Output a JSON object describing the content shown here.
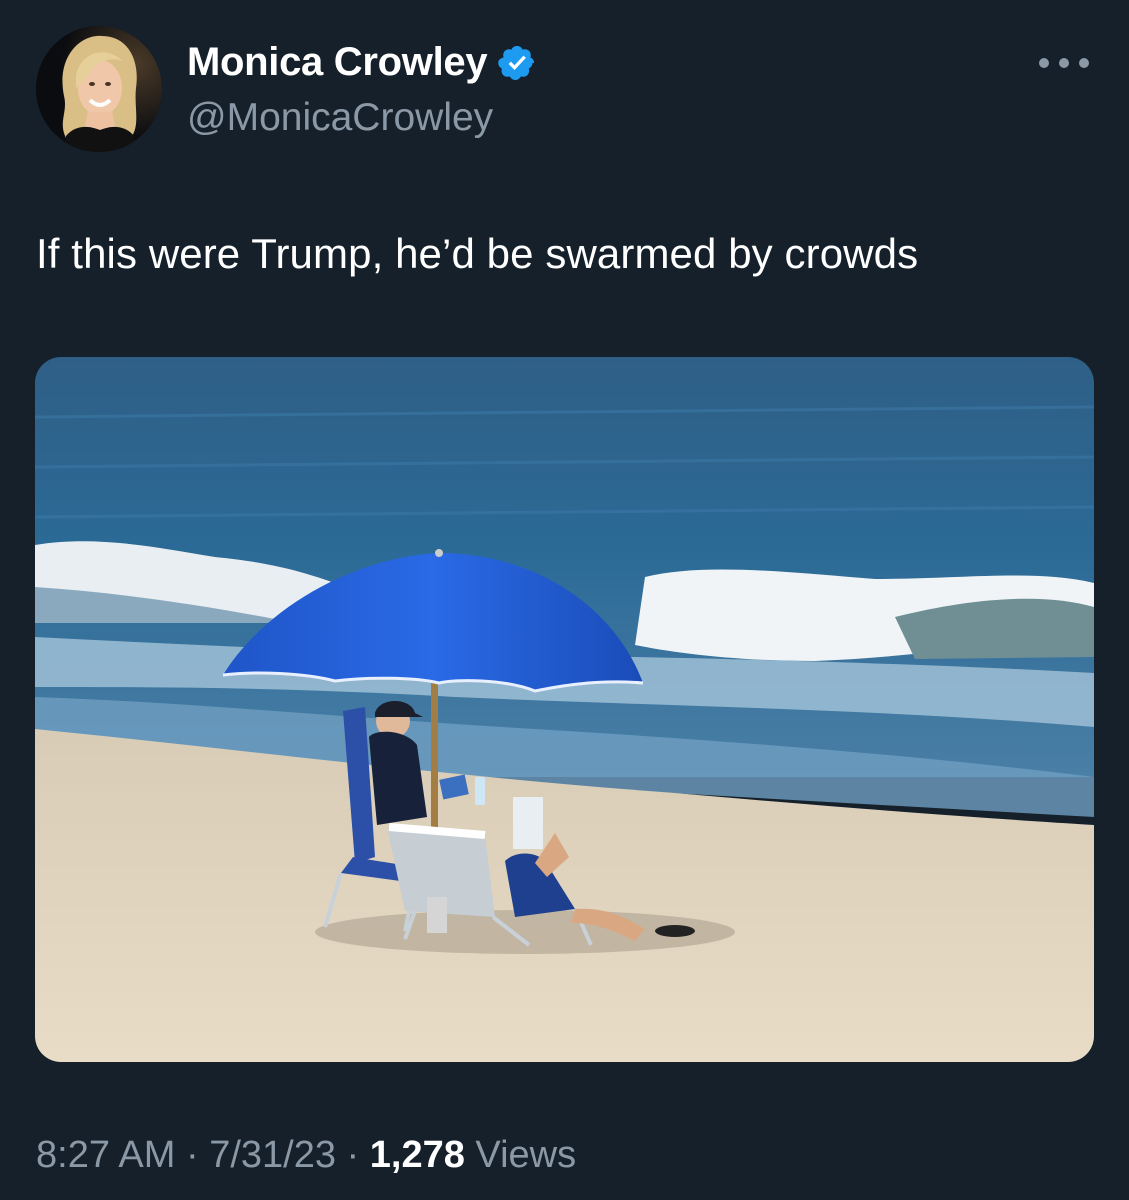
{
  "author": {
    "display_name": "Monica Crowley",
    "handle": "@MonicaCrowley",
    "verified": true
  },
  "tweet": {
    "text": "If this were Trump, he’d be swarmed by crowds"
  },
  "meta": {
    "time": "8:27 AM",
    "separator": " · ",
    "date": "7/31/23",
    "views_count": "1,278",
    "views_label": " Views"
  },
  "icons": {
    "verified": "verified-badge-icon",
    "more": "more-options-icon"
  },
  "colors": {
    "background": "#15202b",
    "secondary_text": "#8b98a5",
    "verified_blue": "#1d9bf0"
  }
}
